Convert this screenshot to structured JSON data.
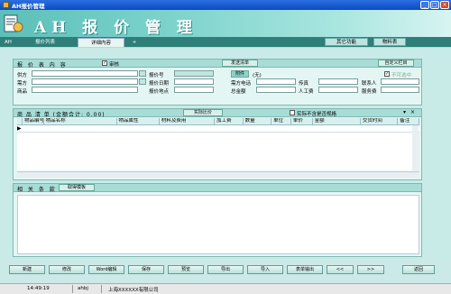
{
  "window": {
    "title": "AH报价管理",
    "buttons": [
      "_",
      "□",
      "×"
    ]
  },
  "banner": {
    "title": "AH 报 价 管 理"
  },
  "tabs": {
    "app": "AH",
    "list": "报价列表",
    "detail": "详细内容",
    "add": "+",
    "other": "其它功能",
    "materials": "物料表"
  },
  "quote": {
    "section_title": "报 价 表 内 容",
    "review_label": "审核",
    "send_email": "发送清单",
    "custom_cols": "自定义栏目",
    "supplier_label": "供方",
    "buyer_label": "需方",
    "product_label": "商品",
    "quote_no_label": "报价号",
    "quote_date_label": "报价日期",
    "quote_place_label": "报价地点",
    "attach_button": "附件",
    "attach_value": "(无)",
    "buyer_phone_label": "需方电话",
    "total_label": "总金额",
    "fax_label": "传真",
    "labor_label": "人工费",
    "contact_label": "联系人",
    "service_label": "服务费",
    "optional_label": "不可选中"
  },
  "items": {
    "section_title": "商 品 清 单 (金额合计: 0.00)",
    "split_button": "实际比价",
    "checkbox_label": "实际不含是否规格",
    "columns": [
      "物品编号",
      "物品名称",
      "物品属性",
      "材料及费用",
      "加工费",
      "数量",
      "单位",
      "单价",
      "金额",
      "交货时间",
      "备注"
    ],
    "row_marker": "▶"
  },
  "terms": {
    "section_title": "相 关 条 款",
    "template_button": "取得模板"
  },
  "toolbar": {
    "buttons": [
      "新建",
      "修改",
      "Word编辑",
      "保存",
      "预览",
      "导出",
      "导入",
      "表单输出",
      "<<",
      ">>",
      "返回"
    ]
  },
  "status": {
    "time": "14:49:19",
    "user": "ahbj",
    "company": "上海XXXXXX有限公司"
  },
  "colors": {
    "accent": "#2f7e79",
    "panel": "#c9ebe7",
    "title_blue": "#0a4ac4"
  }
}
